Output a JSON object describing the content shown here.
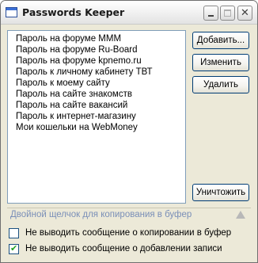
{
  "window": {
    "title": "Passwords Keeper"
  },
  "list": {
    "items": [
      "Пароль на форуме МММ",
      "Пароль на форуме Ru-Board",
      "Пароль на форуме kpnemo.ru",
      "Пароль к личному кабинету ТВТ",
      "Пароль к моему сайту",
      "Пароль на сайте знакомств",
      "Пароль на сайте вакансий",
      "Пароль к интернет-магазину",
      "Мои кошельки на WebMoney"
    ]
  },
  "buttons": {
    "add": "Добавить...",
    "edit": "Изменить",
    "delete": "Удалить",
    "destroy": "Уничтожить"
  },
  "hint": {
    "text": "Двойной щелчок для копирования в буфер"
  },
  "options": [
    {
      "label": "Не выводить сообщение о копировании в буфер",
      "checked": false
    },
    {
      "label": "Не выводить сообщение о добавлении записи",
      "checked": true
    }
  ],
  "colors": {
    "hint_text": "#7a8fb8",
    "check_mark": "#21a121",
    "button_border": "#003c74"
  }
}
